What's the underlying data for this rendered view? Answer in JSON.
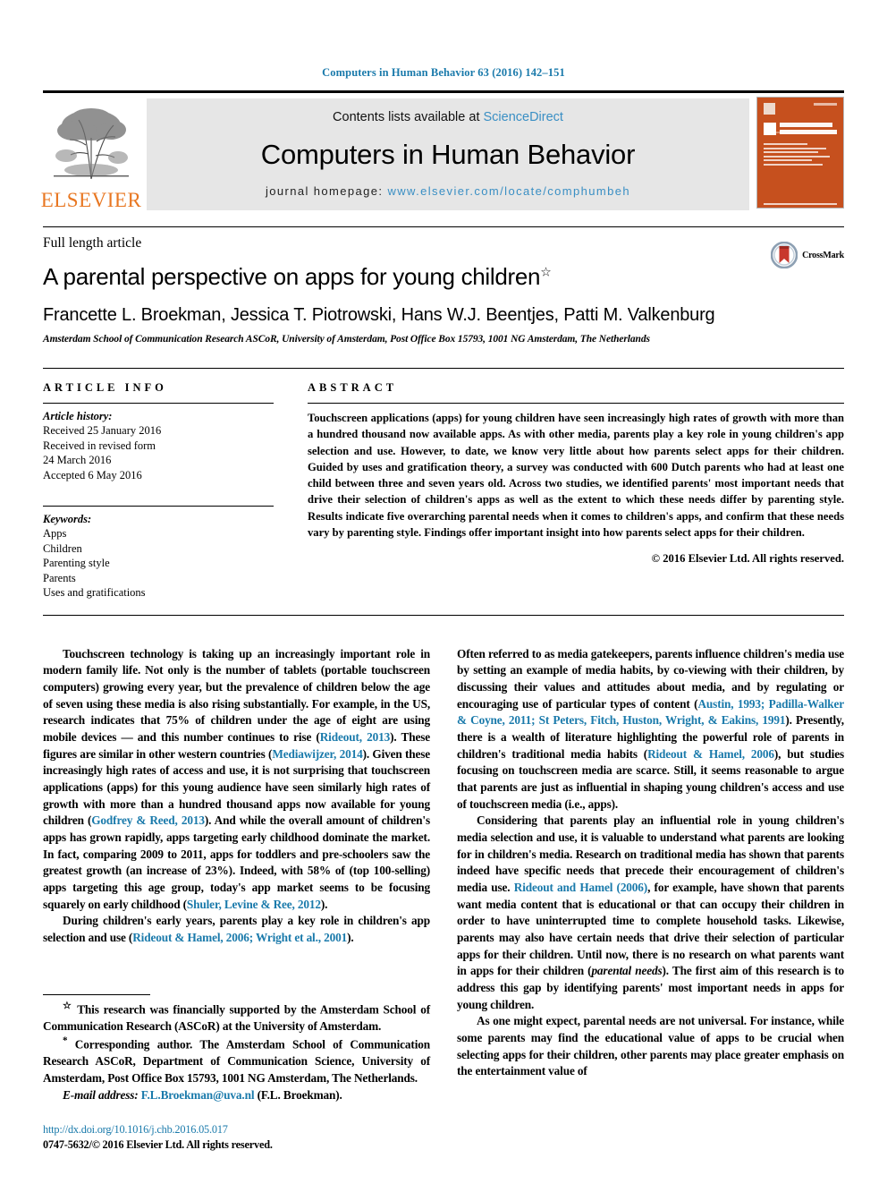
{
  "running_head": "Computers in Human Behavior 63 (2016) 142–151",
  "masthead": {
    "publisher_logo_text": "ELSEVIER",
    "contents_prefix": "Contents lists available at ",
    "contents_link": "ScienceDirect",
    "journal_title": "Computers in Human Behavior",
    "homepage_prefix": "journal homepage: ",
    "homepage_url": "www.elsevier.com/locate/comphumbeh",
    "cover_title_line1": "COMPUTERS IN",
    "cover_title_line2": "HUMAN BEHAVIOR"
  },
  "article": {
    "type": "Full length article",
    "title": "A parental perspective on apps for young children",
    "title_marker": "☆",
    "authors": "Francette L. Broekman, Jessica T. Piotrowski, Hans W.J. Beentjes, Patti M. Valkenburg",
    "author_marker": "*",
    "affiliation": "Amsterdam School of Communication Research ASCoR, University of Amsterdam, Post Office Box 15793, 1001 NG Amsterdam, The Netherlands",
    "crossmark_label": "CrossMark"
  },
  "info": {
    "heading": "ARTICLE INFO",
    "history_label": "Article history:",
    "history": [
      "Received 25 January 2016",
      "Received in revised form",
      "24 March 2016",
      "Accepted 6 May 2016"
    ],
    "keywords_label": "Keywords:",
    "keywords": [
      "Apps",
      "Children",
      "Parenting style",
      "Parents",
      "Uses and gratifications"
    ]
  },
  "abstract": {
    "heading": "ABSTRACT",
    "text": "Touchscreen applications (apps) for young children have seen increasingly high rates of growth with more than a hundred thousand now available apps. As with other media, parents play a key role in young children's app selection and use. However, to date, we know very little about how parents select apps for their children. Guided by uses and gratification theory, a survey was conducted with 600 Dutch parents who had at least one child between three and seven years old. Across two studies, we identified parents' most important needs that drive their selection of children's apps as well as the extent to which these needs differ by parenting style. Results indicate five overarching parental needs when it comes to children's apps, and confirm that these needs vary by parenting style. Findings offer important insight into how parents select apps for their children.",
    "copyright": "© 2016 Elsevier Ltd. All rights reserved."
  },
  "body": {
    "left": {
      "p1_a": "Touchscreen technology is taking up an increasingly important role in modern family life. Not only is the number of tablets (portable touchscreen computers) growing every year, but the prevalence of children below the age of seven using these media is also rising substantially. For example, in the US, research indicates that 75% of children under the age of eight are using mobile devices — and this number continues to rise (",
      "p1_c1": "Rideout, 2013",
      "p1_b": "). These figures are similar in other western countries (",
      "p1_c2": "Mediawijzer, 2014",
      "p1_c": "). Given these increasingly high rates of access and use, it is not surprising that touchscreen applications (apps) for this young audience have seen similarly high rates of growth with more than a hundred thousand apps now available for young children (",
      "p1_c3": "Godfrey & Reed, 2013",
      "p1_d": "). And while the overall amount of children's apps has grown rapidly, apps targeting early childhood dominate the market. In fact, comparing 2009 to 2011, apps for toddlers and pre-schoolers saw the greatest growth (an increase of 23%). Indeed, with 58% of (top 100-selling) apps targeting this age group, today's app market seems to be focusing squarely on early childhood (",
      "p1_c4": "Shuler, Levine & Ree, 2012",
      "p1_e": ").",
      "p2_a": "During children's early years, parents play a key role in children's app selection and use (",
      "p2_c1": "Rideout & Hamel, 2006; Wright et al., 2001",
      "p2_b": ")."
    },
    "right": {
      "p1_a": "Often referred to as media gatekeepers, parents influence children's media use by setting an example of media habits, by co-viewing with their children, by discussing their values and attitudes about media, and by regulating or encouraging use of particular types of content (",
      "p1_c1": "Austin, 1993; Padilla-Walker & Coyne, 2011; St Peters, Fitch, Huston, Wright, & Eakins, 1991",
      "p1_b": "). Presently, there is a wealth of literature highlighting the powerful role of parents in children's traditional media habits (",
      "p1_c2": "Rideout & Hamel, 2006",
      "p1_c": "), but studies focusing on touchscreen media are scarce. Still, it seems reasonable to argue that parents are just as influential in shaping young children's access and use of touchscreen media (i.e., apps).",
      "p2_a": "Considering that parents play an influential role in young children's media selection and use, it is valuable to understand what parents are looking for in children's media. Research on traditional media has shown that parents indeed have specific needs that precede their encouragement of children's media use. ",
      "p2_c1": "Rideout and Hamel (2006)",
      "p2_b": ", for example, have shown that parents want media content that is educational or that can occupy their children in order to have uninterrupted time to complete household tasks. Likewise, parents may also have certain needs that drive their selection of particular apps for their children. Until now, there is no research on what parents want in apps for their children (",
      "p2_i1": "parental needs",
      "p2_c": "). The first aim of this research is to address this gap by identifying parents' most important needs in apps for young children.",
      "p3": "As one might expect, parental needs are not universal. For instance, while some parents may find the educational value of apps to be crucial when selecting apps for their children, other parents may place greater emphasis on the entertainment value of"
    }
  },
  "footnotes": {
    "star_marker": "☆",
    "star_text": "This research was financially supported by the Amsterdam School of Communication Research (ASCoR) at the University of Amsterdam.",
    "corr_marker": "*",
    "corr_text": "Corresponding author. The Amsterdam School of Communication Research ASCoR, Department of Communication Science, University of Amsterdam, Post Office Box 15793, 1001 NG Amsterdam, The Netherlands.",
    "email_label": "E-mail address:",
    "email": "F.L.Broekman@uva.nl",
    "email_owner": "(F.L. Broekman).",
    "doi": "http://dx.doi.org/10.1016/j.chb.2016.05.017",
    "issn_line": "0747-5632/© 2016 Elsevier Ltd. All rights reserved."
  }
}
